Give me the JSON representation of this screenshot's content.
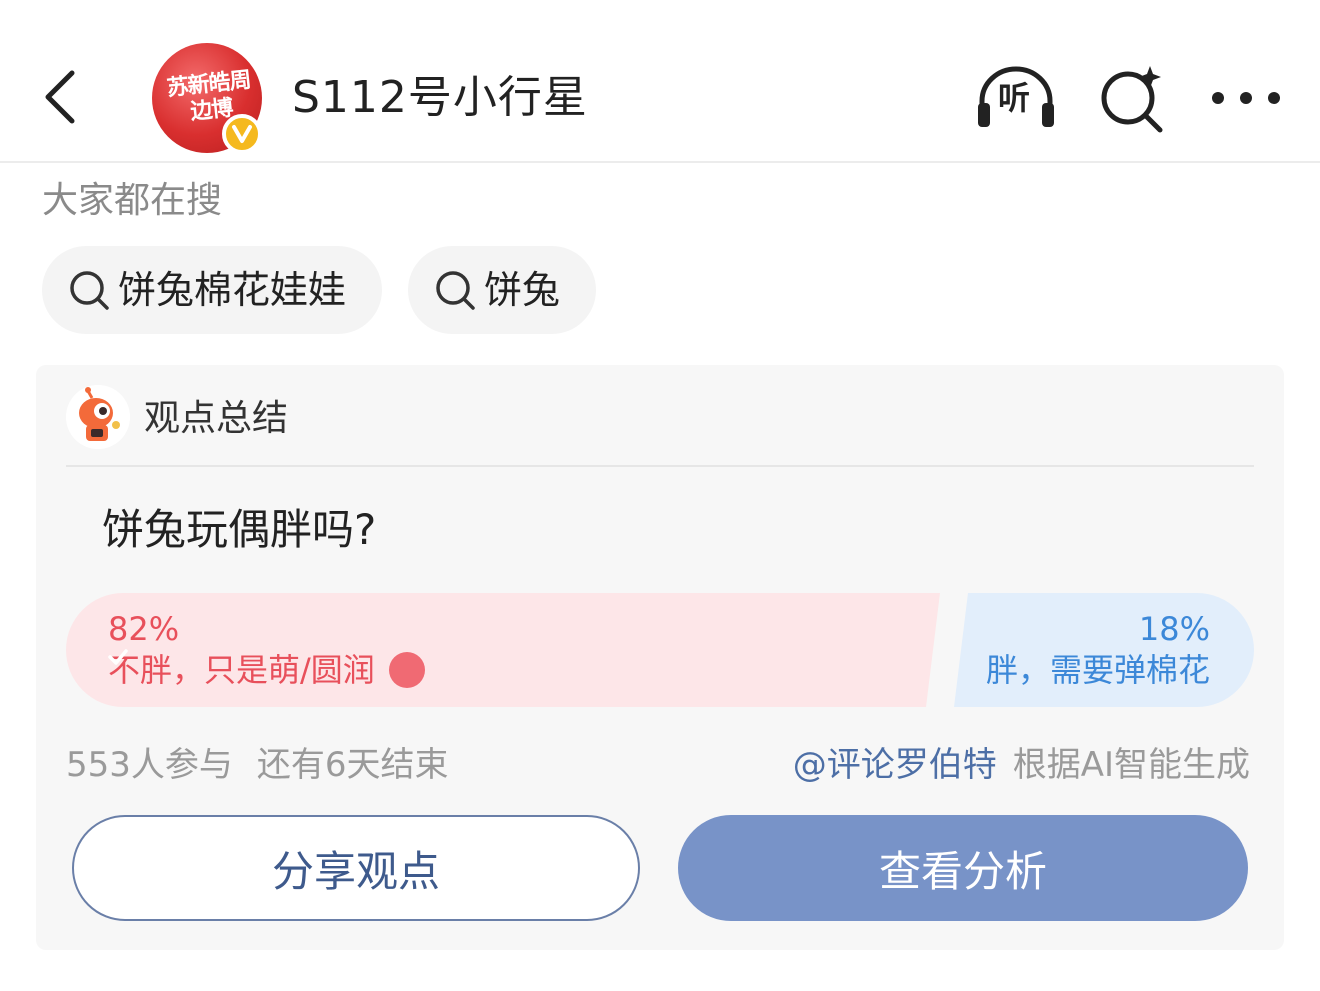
{
  "header": {
    "title": "S112号小行星",
    "avatar_text": "苏新皓周边博",
    "back_icon": "chevron-left-icon",
    "listen_icon_label": "听",
    "search_icon": "search-sparkle-icon",
    "more_icon": "more-dots-icon"
  },
  "trending": {
    "label": "大家都在搜",
    "chips": [
      {
        "label": "饼兔棉花娃娃",
        "icon": "search-icon"
      },
      {
        "label": "饼兔",
        "icon": "search-icon"
      }
    ]
  },
  "opinion": {
    "title": "观点总结",
    "question": "饼兔玩偶胖吗?",
    "options": [
      {
        "percent": "82%",
        "value": 0.82,
        "label": "不胖，只是萌/圆润",
        "selected": true,
        "color": "#e8505b",
        "bg": "#fde6e8"
      },
      {
        "percent": "18%",
        "value": 0.18,
        "label": "胖，需要弹棉花",
        "selected": false,
        "color": "#3c88d8",
        "bg": "#e2eefb"
      }
    ],
    "participants": "553人参与",
    "remaining": "还有6天结束",
    "mention": "@评论罗伯特",
    "generated_note": "根据AI智能生成",
    "share_label": "分享观点",
    "view_label": "查看分析"
  },
  "colors": {
    "accent_blue": "#7893c8",
    "verified_badge": "#f5b91e",
    "mention": "#4d6fa6"
  }
}
